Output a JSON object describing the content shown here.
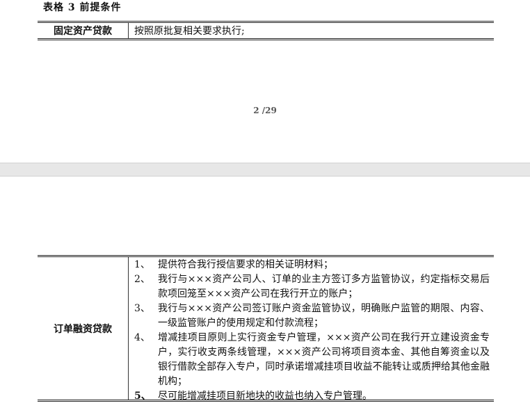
{
  "page1": {
    "table_caption": "表格 3 前提条件",
    "row": {
      "label": "固定资产贷款",
      "value": "按照原批复相关要求执行;"
    },
    "page_number": "2 /29"
  },
  "page2": {
    "label": "订单融资贷款",
    "items": [
      {
        "num": "1、",
        "text": "提供符合我行授信要求的相关证明材料；"
      },
      {
        "num": "2、",
        "text": "我行与×××资产公司人、订单的业主方签订多方监管协议，约定指标交易后款项回笼至×××资产公司在我行开立的账户；"
      },
      {
        "num": "3、",
        "text": "我行与×××资产公司签订账户资金监管协议，明确账户监管的期限、内容、一级监管账户的使用规定和付款流程；"
      },
      {
        "num": "4、",
        "text": "增减挂项目原则上实行资金专户管理，×××资产公司在我行开立建设资金专户，实行收支两条线管理，×××资产公司将项目资本金、其他自筹资金以及银行借款全部存入专户，同时承诺增减挂项目收益不能转让或质押给其他金融机构；"
      },
      {
        "num": "5、",
        "text": "尽可能增减挂项目新地块的收益也纳入专户管理。"
      }
    ]
  }
}
